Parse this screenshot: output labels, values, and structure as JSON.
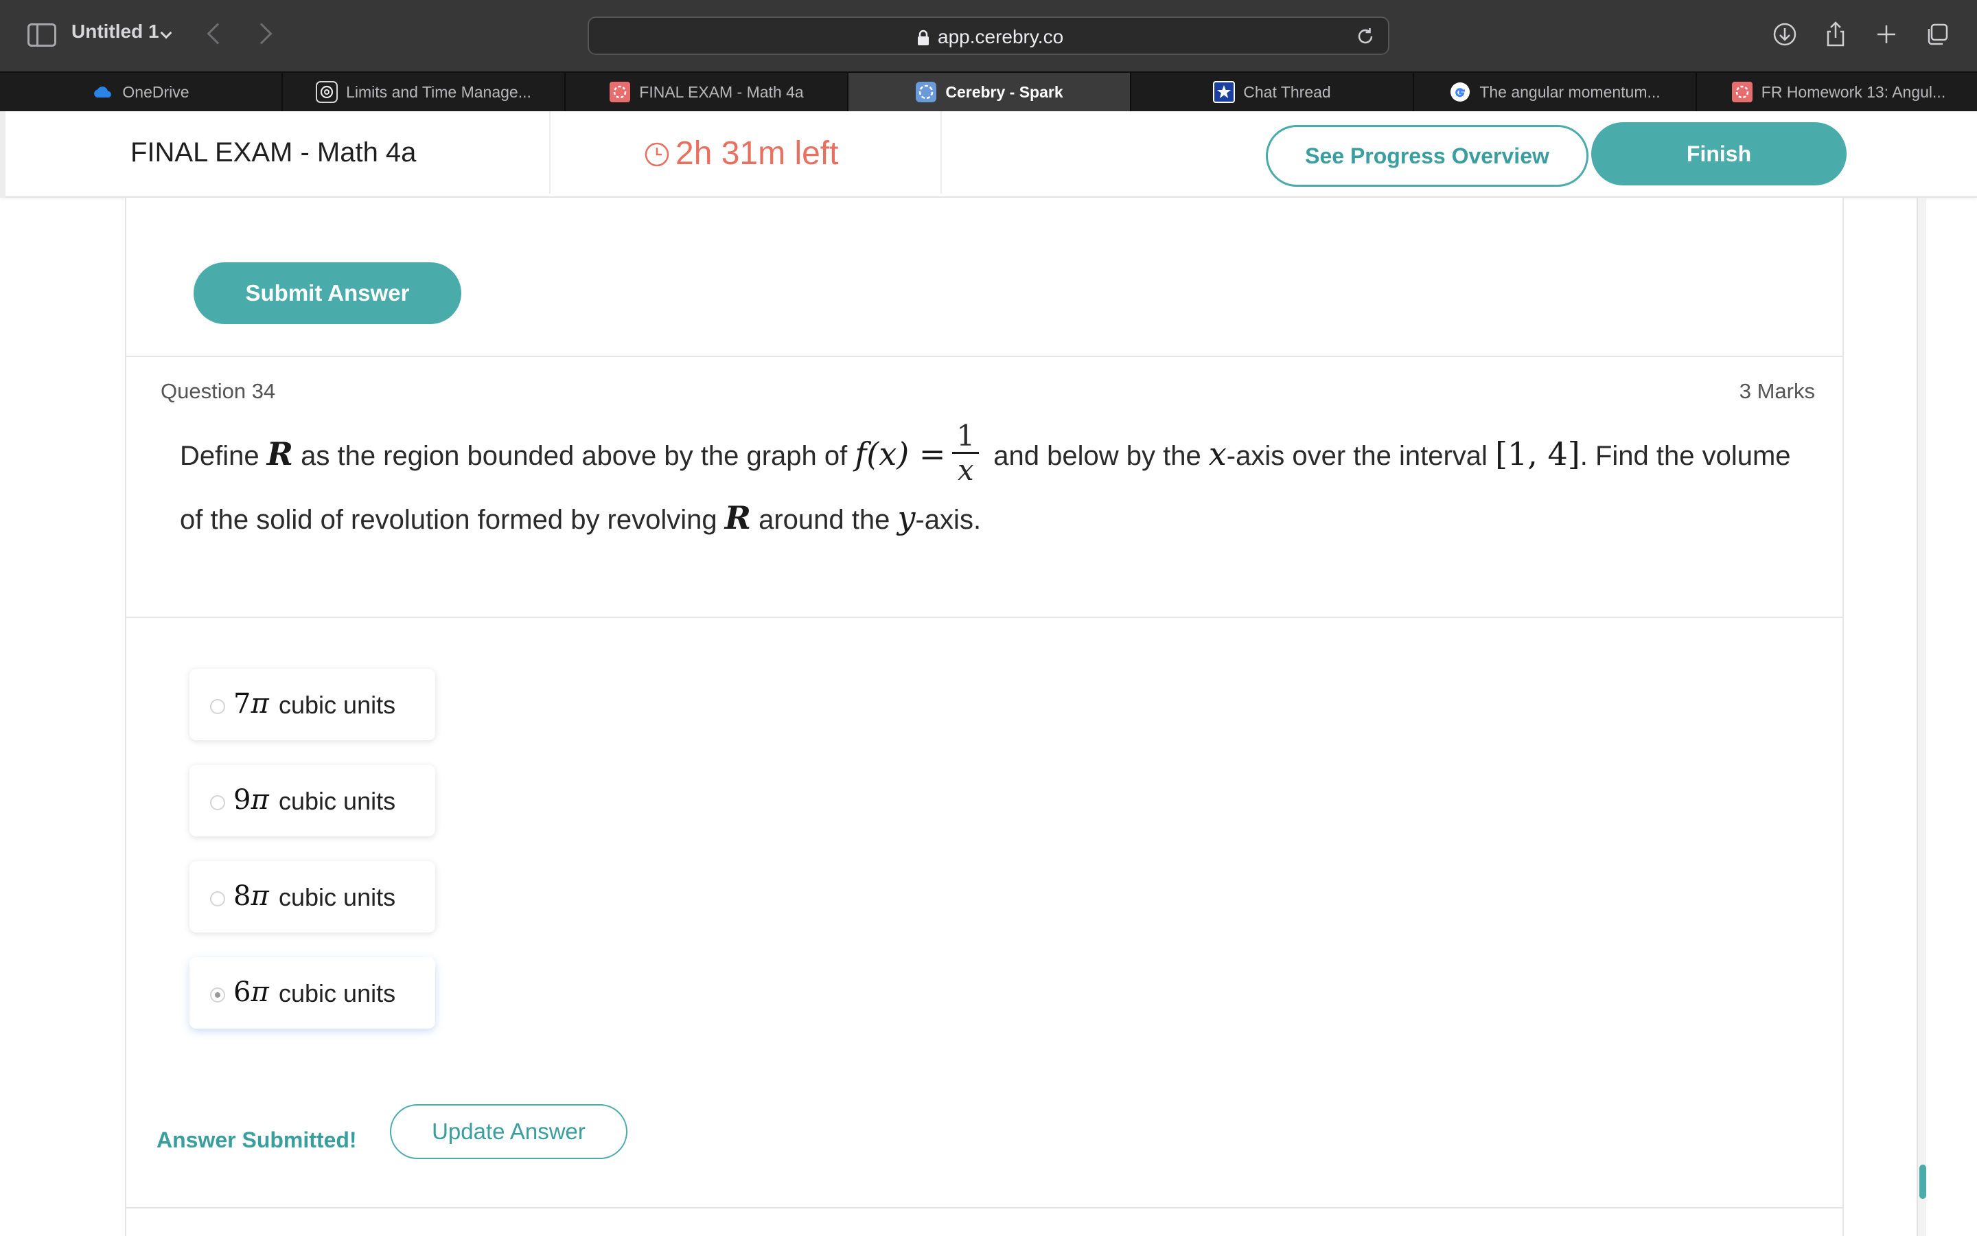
{
  "browser": {
    "window_title": "Untitled 1",
    "url": "app.cerebry.co",
    "tabs": [
      {
        "label": "OneDrive",
        "icon": "onedrive-cloud-icon",
        "active": false
      },
      {
        "label": "Limits and Time Manage...",
        "icon": "openai-logo-icon",
        "active": false
      },
      {
        "label": "FINAL EXAM - Math 4a",
        "icon": "cerebry-red-icon",
        "active": false
      },
      {
        "label": "Cerebry - Spark",
        "icon": "cerebry-spark-icon",
        "active": true
      },
      {
        "label": "Chat Thread",
        "icon": "star-badge-icon",
        "active": false
      },
      {
        "label": "The angular momentum...",
        "icon": "google-g-icon",
        "active": false
      },
      {
        "label": "FR Homework 13: Angul...",
        "icon": "cerebry-red-icon",
        "active": false
      }
    ]
  },
  "header": {
    "exam_title": "FINAL EXAM - Math 4a",
    "timer_value": "2h 31m",
    "timer_suffix": " left",
    "progress_button": "See Progress Overview",
    "finish_button": "Finish"
  },
  "submit_button": "Submit Answer",
  "question": {
    "number_label": "Question 34",
    "marks_label": "3 Marks",
    "text_parts": {
      "p1": "Define ",
      "var_R": "R",
      "p2": " as the region bounded above by the graph of ",
      "func": "f(x) =",
      "frac_num": "1",
      "frac_den": "x",
      "p3": " and below by the ",
      "var_x": "x",
      "p4": "-axis over the interval ",
      "interval": "[1, 4]",
      "p5": ". Find the volume of the solid of revolution formed by revolving ",
      "var_R2": "R",
      "p6": " around the ",
      "var_y": "y",
      "p7": "-axis."
    }
  },
  "options": [
    {
      "coef": "7",
      "pi": "π",
      "label": "cubic units",
      "selected": false
    },
    {
      "coef": "9",
      "pi": "π",
      "label": "cubic units",
      "selected": false
    },
    {
      "coef": "8",
      "pi": "π",
      "label": "cubic units",
      "selected": false
    },
    {
      "coef": "6",
      "pi": "π",
      "label": "cubic units",
      "selected": true
    }
  ],
  "status": {
    "answer_submitted": "Answer Submitted!",
    "update_button": "Update Answer"
  },
  "colors": {
    "accent_teal": "#4aabab",
    "timer_red": "#e8705f",
    "titlebar_bg": "#373738",
    "tabstrip_bg": "#1c1c1d"
  }
}
